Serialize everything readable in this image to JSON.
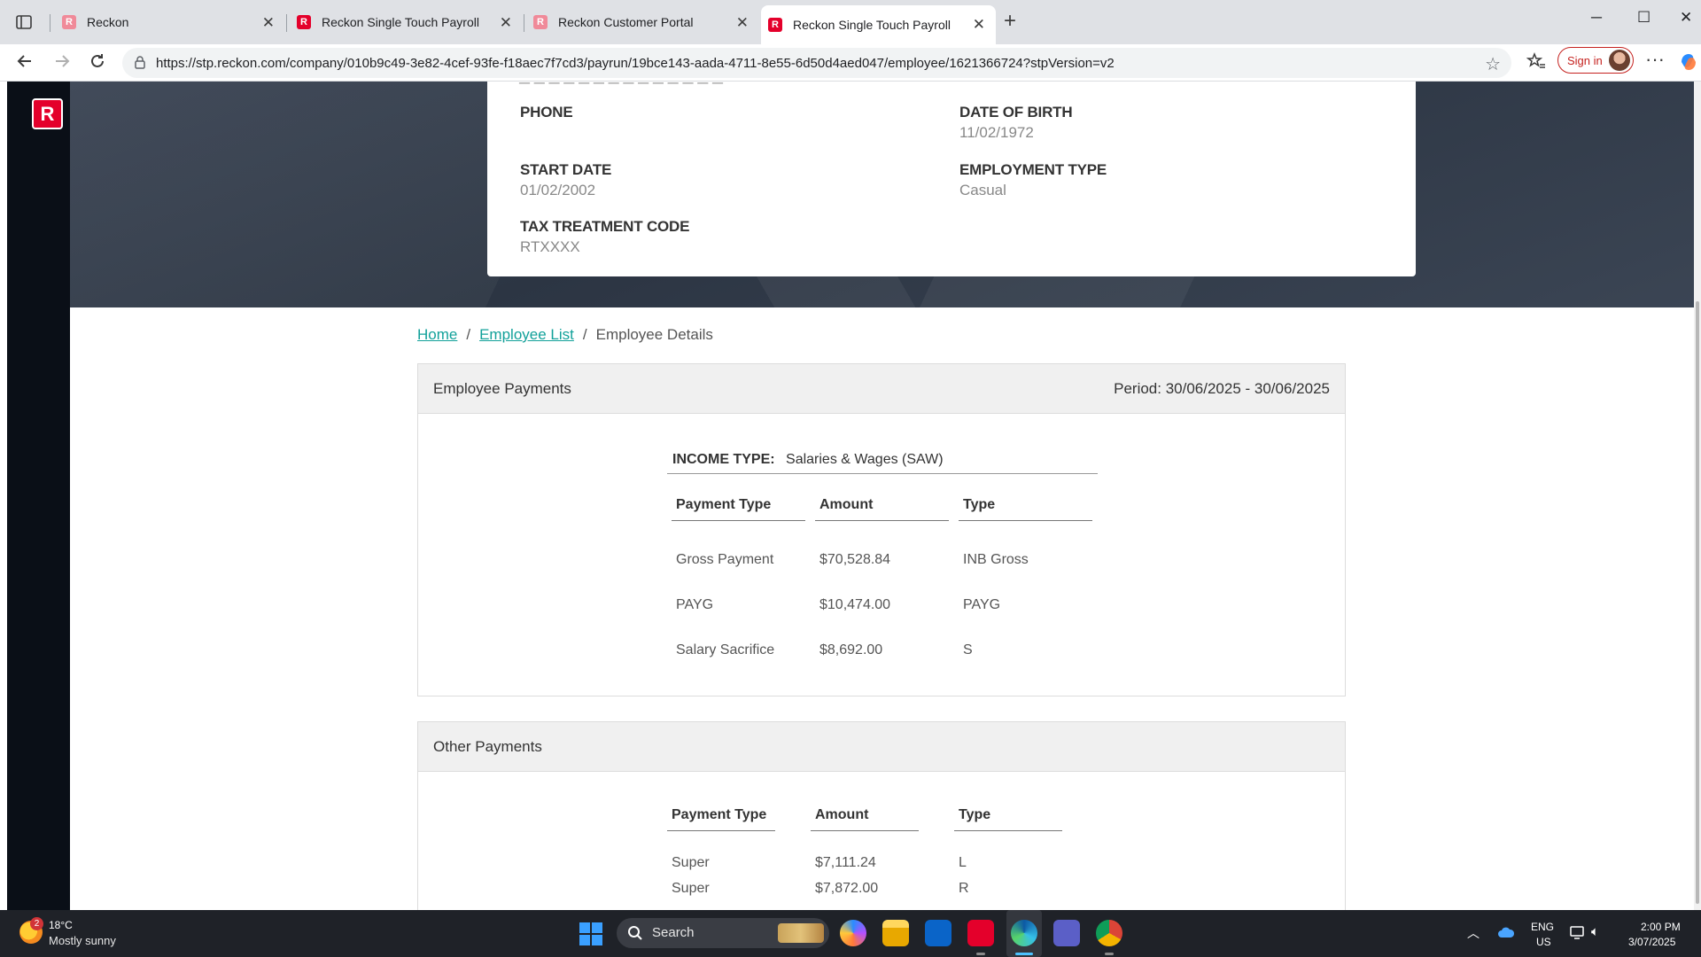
{
  "browser": {
    "tabs": [
      {
        "title": "Reckon",
        "favicon": "R"
      },
      {
        "title": "Reckon Single Touch Payroll",
        "favicon": "R"
      },
      {
        "title": "Reckon Customer Portal",
        "favicon": "R"
      },
      {
        "title": "Reckon Single Touch Payroll",
        "favicon": "R"
      }
    ],
    "url": "https://stp.reckon.com/company/010b9c49-3e82-4cef-93fe-f18aec7f7cd3/payrun/19bce143-aada-4711-8e55-6d50d4aed047/employee/1621366724?stpVersion=v2",
    "signin_label": "Sign in"
  },
  "app": {
    "logo_letter": "R",
    "brand_color": "#e4002b",
    "link_color": "#12a19a"
  },
  "profile": {
    "phone_label": "PHONE",
    "phone_value": "",
    "dob_label": "DATE OF BIRTH",
    "dob_value": "11/02/1972",
    "start_label": "START DATE",
    "start_value": "01/02/2002",
    "employment_label": "EMPLOYMENT TYPE",
    "employment_value": "Casual",
    "tax_label": "TAX TREATMENT CODE",
    "tax_value": "RTXXXX"
  },
  "breadcrumb": {
    "home": "Home",
    "employee_list": "Employee List",
    "current": "Employee Details",
    "separator": "/"
  },
  "employee_payments": {
    "title": "Employee Payments",
    "period": "Period: 30/06/2025 - 30/06/2025",
    "income_type_label": "INCOME TYPE:",
    "income_type_value": "Salaries & Wages (SAW)",
    "columns": [
      "Payment Type",
      "Amount",
      "Type"
    ],
    "rows": [
      {
        "payment_type": "Gross Payment",
        "amount": "$70,528.84",
        "type": "INB Gross"
      },
      {
        "payment_type": "PAYG",
        "amount": "$10,474.00",
        "type": "PAYG"
      },
      {
        "payment_type": "Salary Sacrifice",
        "amount": "$8,692.00",
        "type": "S"
      }
    ]
  },
  "other_payments": {
    "title": "Other Payments",
    "columns": [
      "Payment Type",
      "Amount",
      "Type"
    ],
    "rows": [
      {
        "payment_type": "Super",
        "amount": "$7,111.24",
        "type": "L"
      },
      {
        "payment_type": "Super",
        "amount": "$7,872.00",
        "type": "R"
      }
    ]
  },
  "taskbar": {
    "weather_badge": "2",
    "temperature": "18°C",
    "weather_desc": "Mostly sunny",
    "search_placeholder": "Search",
    "lang_line1": "ENG",
    "lang_line2": "US",
    "time": "2:00 PM",
    "date": "3/07/2025",
    "icons": [
      "start-icon",
      "copilot-icon",
      "file-explorer-icon",
      "outlook-icon",
      "reckon-app-icon",
      "edge-icon",
      "teams-icon",
      "chrome-icon"
    ]
  }
}
